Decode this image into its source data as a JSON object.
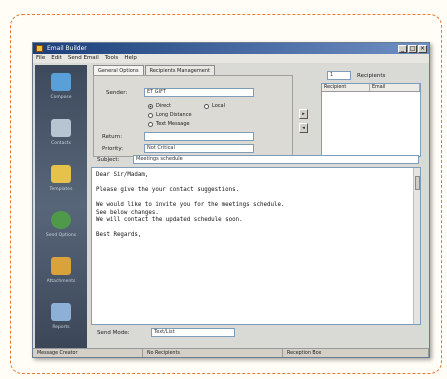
{
  "window": {
    "title": "Email Builder",
    "controls": [
      "_",
      "□",
      "×"
    ]
  },
  "menu": [
    "File",
    "Edit",
    "Send Email",
    "Tools",
    "Help"
  ],
  "nav": [
    {
      "label": "Compose",
      "icon": "compose-icon",
      "color": "#5aa0d8"
    },
    {
      "label": "Contacts",
      "icon": "contacts-icon",
      "color": "#b7c4d2"
    },
    {
      "label": "Templates",
      "icon": "folder-icon",
      "color": "#e6c24a"
    },
    {
      "label": "Send Options",
      "icon": "globe-icon",
      "color": "#4f9a4a"
    },
    {
      "label": "Attachments",
      "icon": "paperclip-icon",
      "color": "#d9a23a"
    },
    {
      "label": "Reports",
      "icon": "report-icon",
      "color": "#8fb0d6"
    }
  ],
  "tabs": [
    {
      "label": "General Options",
      "active": true
    },
    {
      "label": "Recipients Management",
      "active": false
    }
  ],
  "form": {
    "sender_label": "Sender:",
    "sender_value": "ET GIFT",
    "radio_a": "Direct",
    "radio_b": "Local",
    "radio_c": "Long Distance",
    "radio_d": "Text Message",
    "reply_label": "Return:",
    "reply_value": "",
    "priority_label": "Priority:",
    "priority_value": "Not Critical"
  },
  "recipients": {
    "count_value": "1",
    "count_label": "Recipients",
    "columns": [
      "Recipient",
      "Email"
    ]
  },
  "subject": {
    "label": "Subject:",
    "value": "Meetings schedule"
  },
  "body_lines": [
    "Dear Sir/Madam,",
    "",
    "Please give the your contact suggestions.",
    "",
    "We would like to invite you for the meetings schedule.",
    "See below changes.",
    "We will contact the updated schedule soon.",
    "",
    "Best Regards,"
  ],
  "footer": {
    "label": "Send Mode:",
    "value": "Text/List"
  },
  "status": [
    "Message Creator",
    "No Recipients",
    "Reception Box"
  ]
}
